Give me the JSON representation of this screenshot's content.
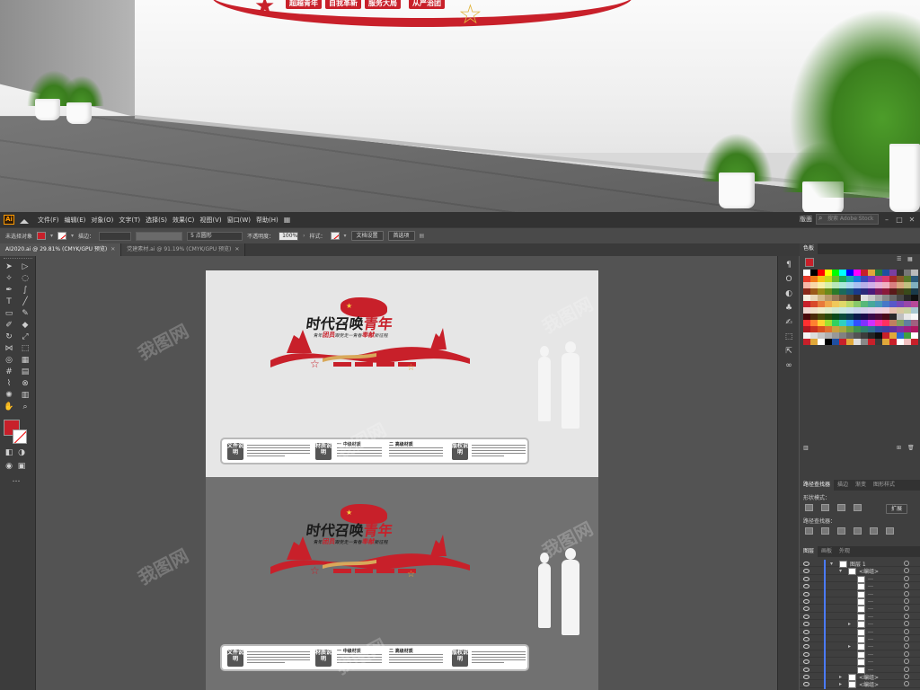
{
  "room": {
    "wall_tags": [
      "超越青年",
      "自我革新",
      "服务大局",
      "从严治团"
    ]
  },
  "menubar": {
    "logo": "Ai",
    "items": [
      "文件(F)",
      "编辑(E)",
      "对象(O)",
      "文字(T)",
      "选择(S)",
      "效果(C)",
      "视图(V)",
      "窗口(W)",
      "帮助(H)"
    ],
    "workspace": "版面",
    "search_placeholder": "搜索 Adobe Stock"
  },
  "control": {
    "selection": "未选择对象",
    "stroke_label": "描边：",
    "brush": "5 点圆形",
    "opacity_label": "不透明度：",
    "opacity": "100%",
    "style_label": "样式：",
    "doc_setup": "文档设置",
    "prefs": "首选项"
  },
  "tabs": [
    {
      "label": "AI2020.ai @ 29.81% (CMYK/GPU 预览)",
      "active": true
    },
    {
      "label": "党建素材.ai @ 91.19% (CMYK/GPU 预览)",
      "active": false
    }
  ],
  "artwork": {
    "title_black": "时代召唤",
    "title_red": "青年",
    "subtitle_pre": "青年",
    "subtitle_red1": "团员",
    "subtitle_mid": "跟党走一青春",
    "subtitle_red2": "奉献",
    "subtitle_post": "新征程",
    "info_boxes": [
      {
        "label": "文件说明",
        "text": "文件说明"
      },
      {
        "label": "材质说明",
        "text": "材质说明"
      },
      {
        "label": "版权说明",
        "text": "版权说明"
      }
    ],
    "info_heads": [
      "一 中级材质",
      "二 高级材质"
    ]
  },
  "panels": {
    "swatches_tab": "色板",
    "pathfinder_tabs": [
      "路径查找器",
      "描边",
      "渐变",
      "图形样式"
    ],
    "shape_modes": "形状模式：",
    "expand": "扩展",
    "pathfinders": "路径查找器：",
    "layers_tabs": [
      "图层",
      "画板",
      "外观"
    ],
    "layer_top": "图层 1",
    "group_label": "<编组>",
    "colors": {
      "accent": "#c8202a",
      "gold": "#e0a83a",
      "selection": "#4a7bff"
    }
  },
  "watermark": "我图网"
}
